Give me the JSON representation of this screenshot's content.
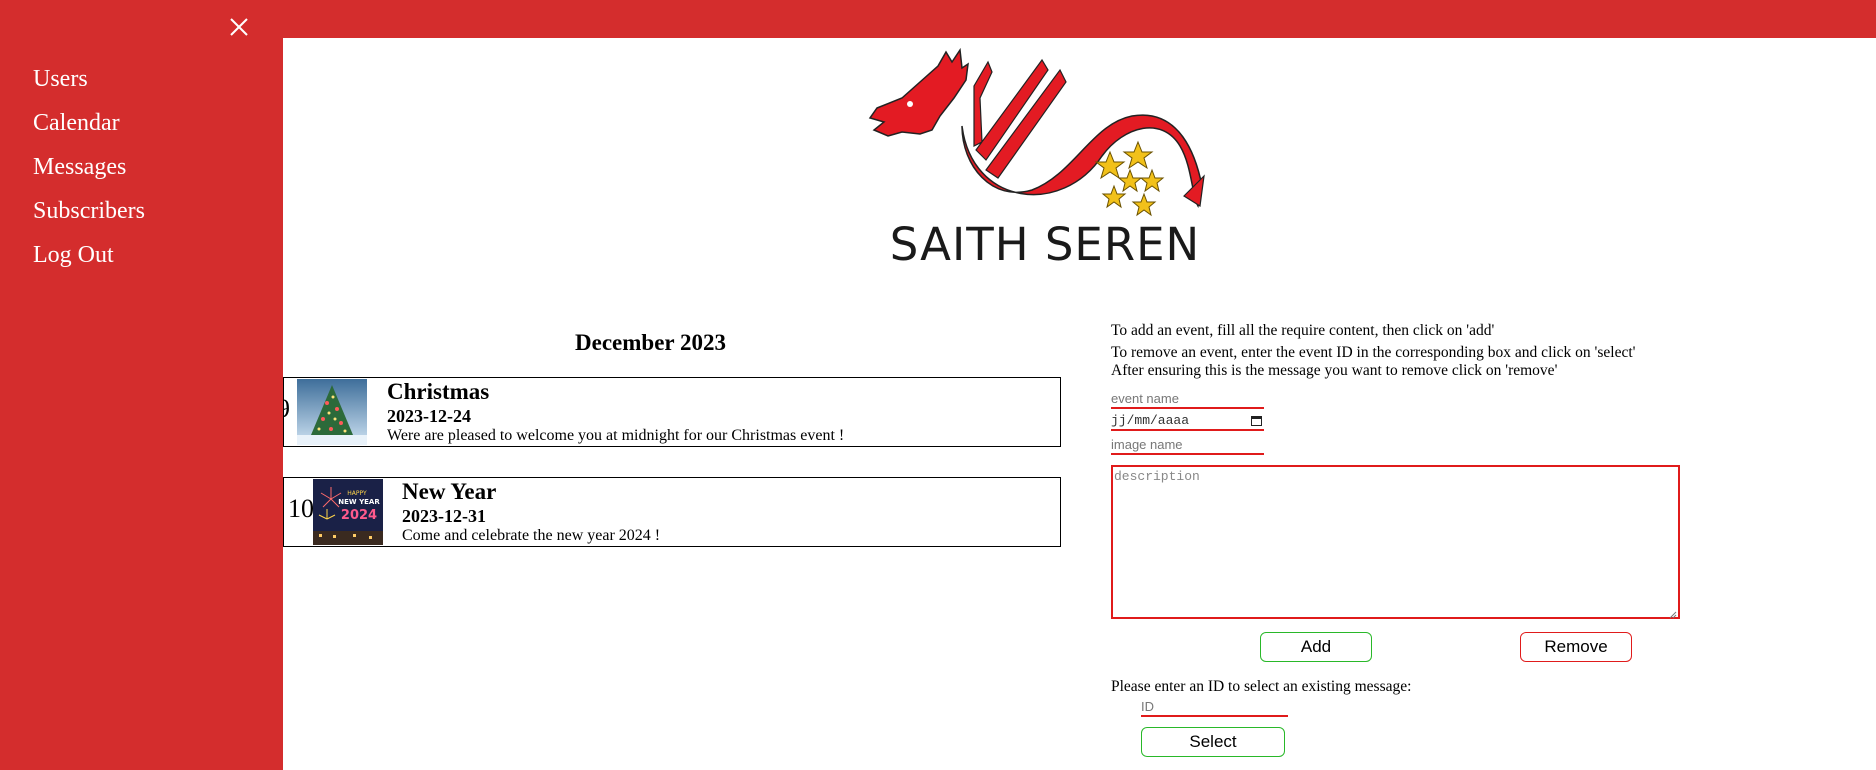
{
  "sidebar": {
    "close_icon": "close-icon",
    "items": [
      {
        "label": "Users"
      },
      {
        "label": "Calendar"
      },
      {
        "label": "Messages"
      },
      {
        "label": "Subscribers"
      },
      {
        "label": "Log Out"
      }
    ]
  },
  "logo": {
    "text": "SAITH SEREN"
  },
  "calendar": {
    "month_title": "December 2023",
    "events": [
      {
        "id": "9",
        "title": "Christmas",
        "date": "2023-12-24",
        "description": "Were are pleased to welcome you at midnight for our Christmas event !",
        "image": "christmas-tree-image"
      },
      {
        "id": "10",
        "title": "New Year",
        "date": "2023-12-31",
        "description": "Come and celebrate the new year 2024 !",
        "image": "new-year-fireworks-image"
      }
    ]
  },
  "form": {
    "instructions": [
      "To add an event, fill all the require content, then click on 'add'",
      "To remove an event, enter the event ID in the corresponding box and click on 'select'",
      "After ensuring this is the message you want to remove click on 'remove'"
    ],
    "event_name_placeholder": "event name",
    "date_placeholder": "jj/mm/aaaa",
    "image_name_placeholder": "image name",
    "description_placeholder": "description",
    "add_label": "Add",
    "remove_label": "Remove",
    "select_prompt": "Please enter an ID to select an existing message:",
    "id_placeholder": "ID",
    "select_label": "Select"
  },
  "colors": {
    "brand_red": "#d42d2d",
    "field_red": "#e01b1b",
    "button_green": "#29b829"
  }
}
